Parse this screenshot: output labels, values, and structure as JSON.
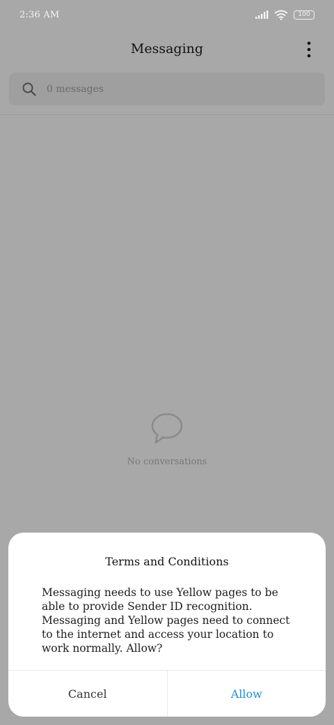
{
  "status_bar": {
    "time": "2:36 AM",
    "battery": "100",
    "icons": [
      "signal-icon",
      "wifi-icon",
      "battery-icon"
    ]
  },
  "header": {
    "title": "Messaging",
    "menu_icon": "more-vertical-icon"
  },
  "search": {
    "icon": "search-icon",
    "placeholder": "0 messages"
  },
  "empty_state": {
    "icon": "chat-bubble-icon",
    "text": "No conversations"
  },
  "dialog": {
    "title": "Terms and Conditions",
    "body": "Messaging needs to use Yellow pages to be able to provide Sender ID recognition. Messaging and Yellow pages need to connect to the internet and access your location to work normally. Allow?",
    "cancel_label": "Cancel",
    "allow_label": "Allow"
  },
  "colors": {
    "overlay_background": "#a8a8a8",
    "accent": "#1a8fd8",
    "dialog_background": "#ffffff"
  }
}
